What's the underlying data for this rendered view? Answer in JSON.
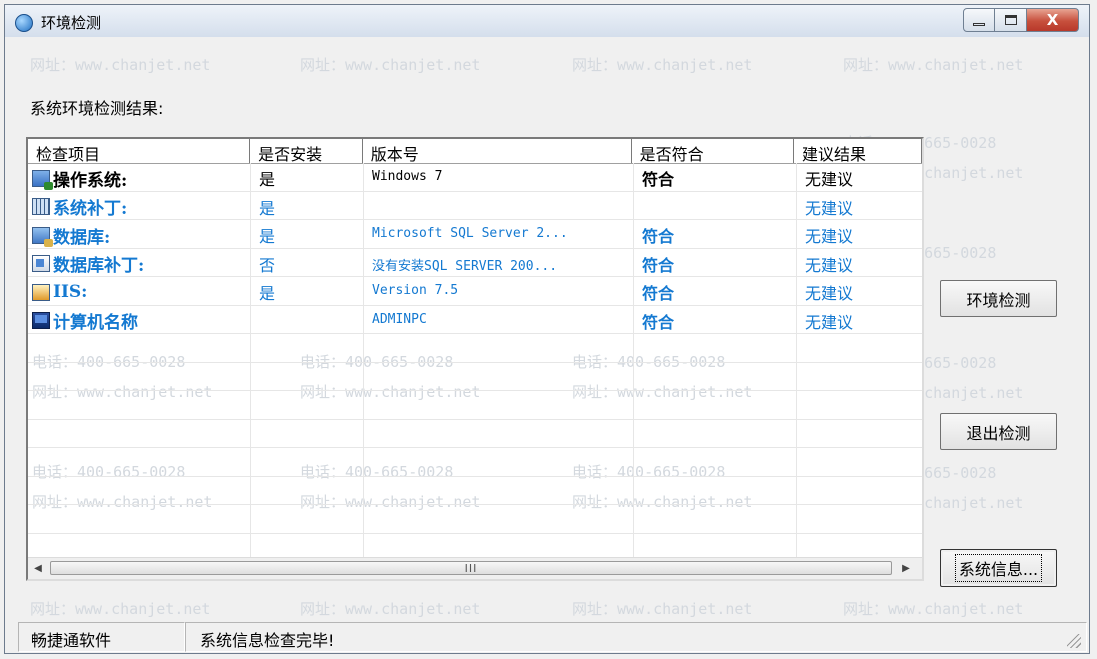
{
  "window": {
    "title": "环境检测",
    "icon": "app-globe-icon",
    "controls": {
      "minimize": "minimize-icon",
      "maximize": "maximize-icon",
      "close": "X"
    }
  },
  "watermarks": {
    "phone": "电话：400-665-0028",
    "site": "网址：www.chanjet.net"
  },
  "section_label": "系统环境检测结果:",
  "table": {
    "columns": [
      "检查项目",
      "是否安装",
      "版本号",
      "是否符合",
      "建议结果"
    ],
    "rows": [
      {
        "icon": "os-icon",
        "item": "操作系统:",
        "installed": "是",
        "version": "Windows 7",
        "compliant": "符合",
        "suggestion": "无建议"
      },
      {
        "icon": "patch-icon",
        "item": "系统补丁:",
        "installed": "是",
        "version": "",
        "compliant": "",
        "suggestion": "无建议"
      },
      {
        "icon": "database-icon",
        "item": "数据库:",
        "installed": "是",
        "version": "Microsoft SQL Server 2...",
        "compliant": "符合",
        "suggestion": "无建议"
      },
      {
        "icon": "database-patch-icon",
        "item": "数据库补丁:",
        "installed": "否",
        "version": "没有安装SQL SERVER 200...",
        "compliant": "符合",
        "suggestion": "无建议"
      },
      {
        "icon": "iis-icon",
        "item": "IIS:",
        "installed": "是",
        "version": "Version 7.5",
        "compliant": "符合",
        "suggestion": "无建议"
      },
      {
        "icon": "computer-icon",
        "item": "计算机名称",
        "installed": "",
        "version": "ADMINPC",
        "compliant": "符合",
        "suggestion": "无建议"
      }
    ]
  },
  "scrollbar": {
    "thumb_grip": "III"
  },
  "buttons": {
    "check": "环境检测",
    "exit": "退出检测",
    "sysinfo": "系统信息..."
  },
  "status": {
    "company": "畅捷通软件",
    "message": "系统信息检查完毕!"
  },
  "colors": {
    "link_blue": "#1479d1",
    "close_red": "#c7503d"
  }
}
